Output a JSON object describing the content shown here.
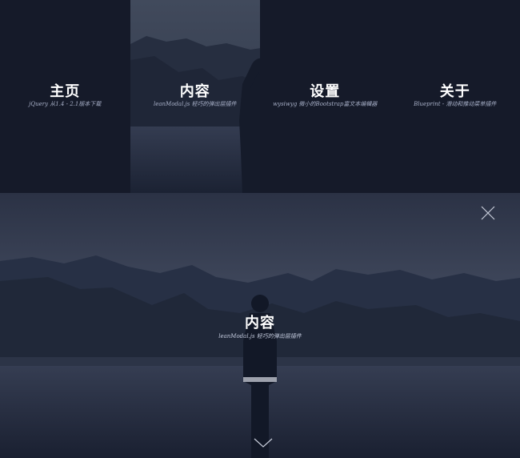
{
  "menu": [
    {
      "label": "主页",
      "sub": "jQuery 从1.4 - 2.1版本下载"
    },
    {
      "label": "内容",
      "sub": "leanModal.js 轻巧的弹出层插件"
    },
    {
      "label": "设置",
      "sub": "wysiwyg 微小的Bootstrap富文本编辑器"
    },
    {
      "label": "关于",
      "sub": "Blueprint - 滑动和推动菜单插件"
    }
  ],
  "panel": {
    "title": "内容",
    "subtitle": "leanModal.js 轻巧的弹出层插件"
  },
  "colors": {
    "background": "#151a29",
    "text": "#ffffff",
    "subtext": "#a8b0c8"
  },
  "icons": {
    "close": "close-icon",
    "scroll_down": "chevron-down-icon"
  }
}
